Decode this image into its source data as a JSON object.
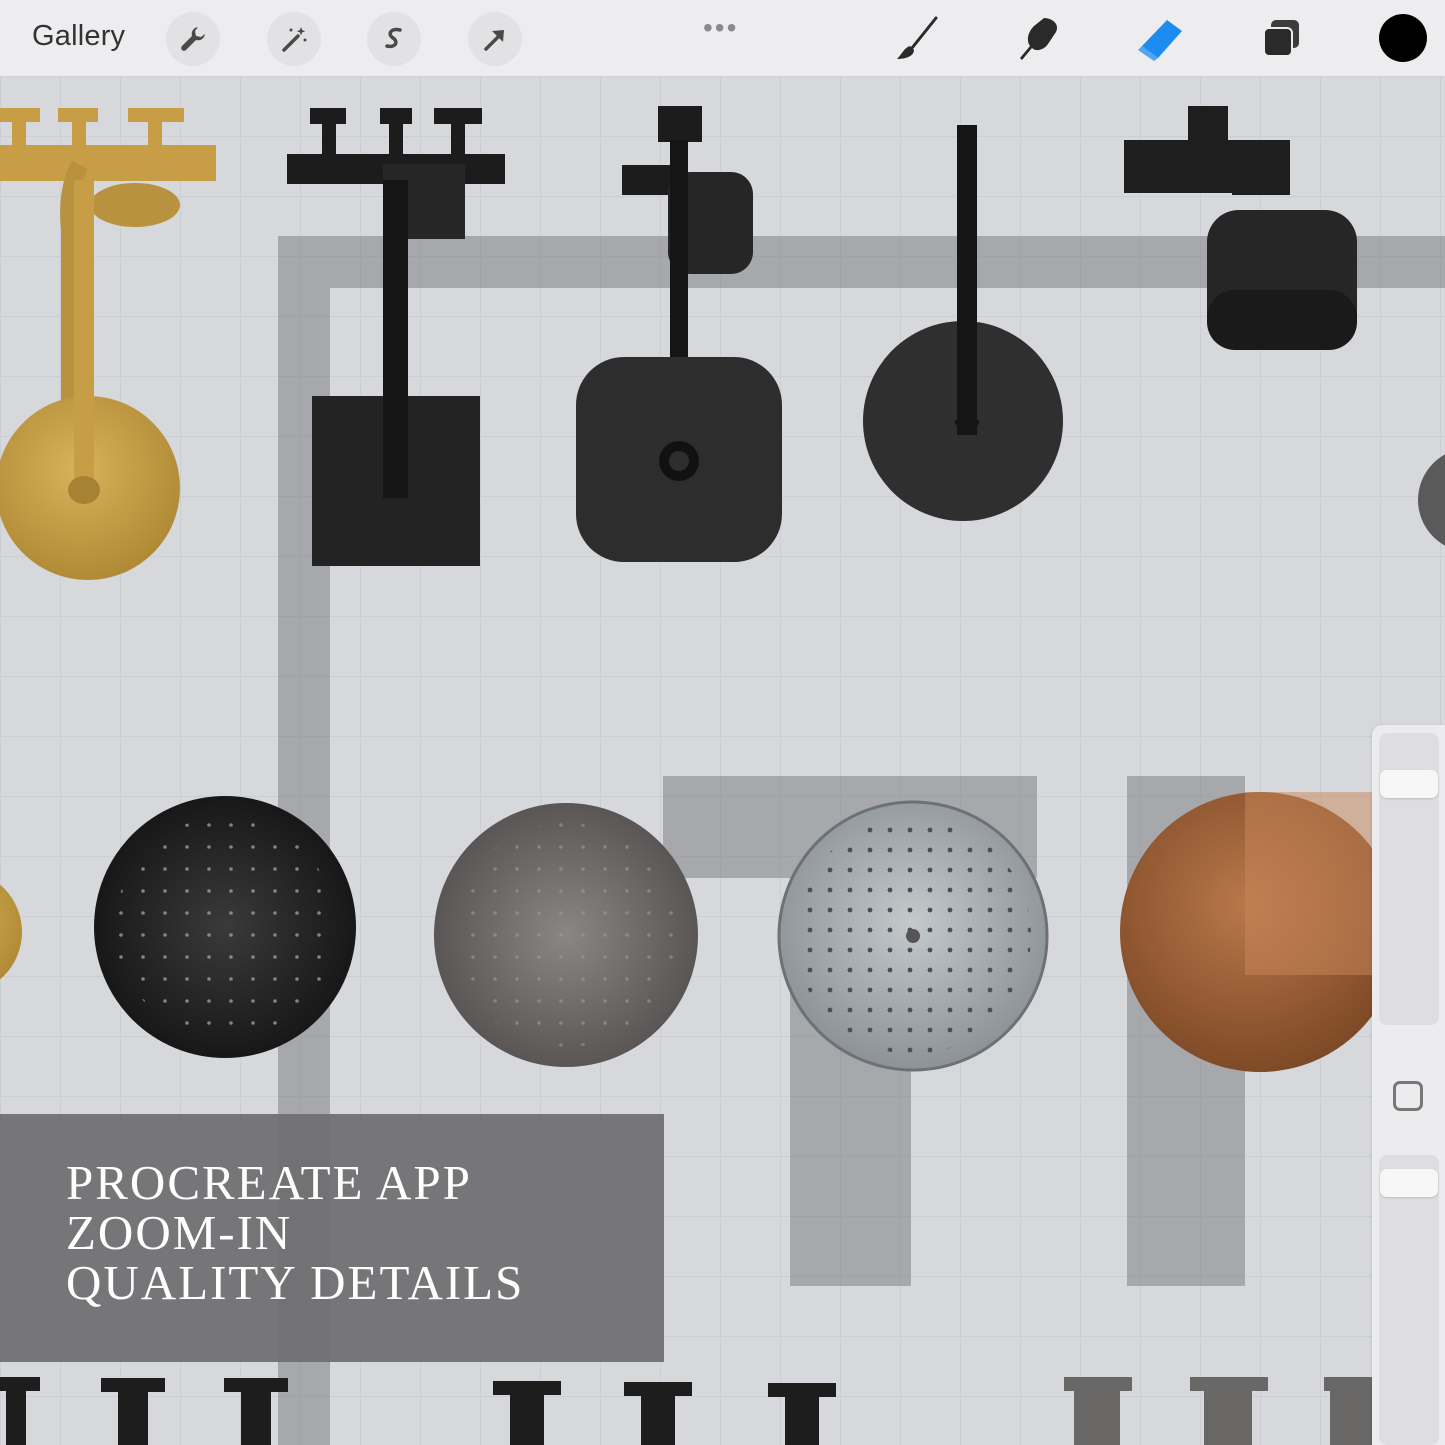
{
  "toolbar": {
    "gallery_label": "Gallery",
    "left_tools": [
      "wrench-icon",
      "magic-wand-icon",
      "selection-icon",
      "transform-arrow-icon"
    ],
    "more_label": "•••",
    "right_tools": [
      "brush-icon",
      "smudge-icon",
      "eraser-icon",
      "layers-icon"
    ],
    "active_tool": "eraser",
    "accent_color": "#1d8cf0",
    "current_color": "#000000"
  },
  "sidebar": {
    "brush_size_level": 0.95,
    "opacity_level": 0.95,
    "modifier_icon": "modifier-square-icon"
  },
  "caption": {
    "line1": "PROCREATE APP",
    "line2": "ZOOM-IN",
    "line3": "QUALITY DETAILS"
  }
}
